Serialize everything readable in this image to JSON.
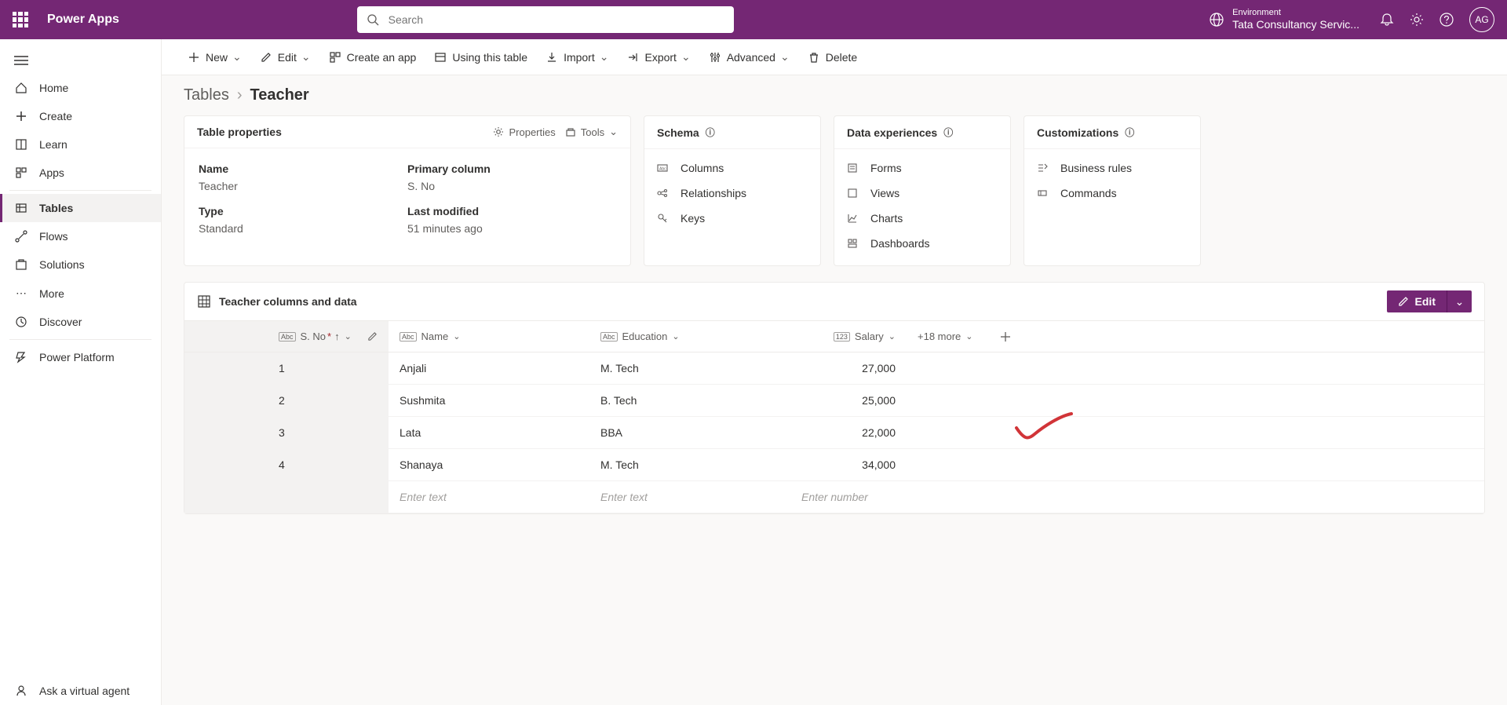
{
  "header": {
    "brand": "Power Apps",
    "search_placeholder": "Search",
    "env_label": "Environment",
    "env_name": "Tata Consultancy Servic...",
    "avatar_initials": "AG"
  },
  "sidebar": {
    "items": [
      {
        "label": "Home"
      },
      {
        "label": "Create"
      },
      {
        "label": "Learn"
      },
      {
        "label": "Apps"
      },
      {
        "label": "Tables"
      },
      {
        "label": "Flows"
      },
      {
        "label": "Solutions"
      },
      {
        "label": "More"
      },
      {
        "label": "Discover"
      }
    ],
    "power_platform": "Power Platform",
    "ask_agent": "Ask a virtual agent"
  },
  "commandbar": {
    "new": "New",
    "edit": "Edit",
    "create_app": "Create an app",
    "using_table": "Using this table",
    "import": "Import",
    "export": "Export",
    "advanced": "Advanced",
    "delete": "Delete"
  },
  "breadcrumb": {
    "parent": "Tables",
    "current": "Teacher"
  },
  "cards": {
    "props": {
      "title": "Table properties",
      "properties_btn": "Properties",
      "tools_btn": "Tools",
      "name_label": "Name",
      "name_value": "Teacher",
      "type_label": "Type",
      "type_value": "Standard",
      "primary_label": "Primary column",
      "primary_value": "S. No",
      "modified_label": "Last modified",
      "modified_value": "51 minutes ago"
    },
    "schema": {
      "title": "Schema",
      "columns": "Columns",
      "relationships": "Relationships",
      "keys": "Keys"
    },
    "data_exp": {
      "title": "Data experiences",
      "forms": "Forms",
      "views": "Views",
      "charts": "Charts",
      "dashboards": "Dashboards"
    },
    "custom": {
      "title": "Customizations",
      "business_rules": "Business rules",
      "commands": "Commands"
    }
  },
  "table_section": {
    "title": "Teacher columns and data",
    "edit_label": "Edit",
    "more_columns": "+18 more",
    "col_sno": "S. No",
    "col_name": "Name",
    "col_education": "Education",
    "col_salary": "Salary",
    "rows": [
      {
        "sno": "1",
        "name": "Anjali",
        "education": "M. Tech",
        "salary": "27,000"
      },
      {
        "sno": "2",
        "name": "Sushmita",
        "education": "B. Tech",
        "salary": "25,000"
      },
      {
        "sno": "3",
        "name": "Lata",
        "education": "BBA",
        "salary": "22,000"
      },
      {
        "sno": "4",
        "name": "Shanaya",
        "education": "M. Tech",
        "salary": "34,000"
      }
    ],
    "placeholder_text": "Enter text",
    "placeholder_number": "Enter number"
  }
}
